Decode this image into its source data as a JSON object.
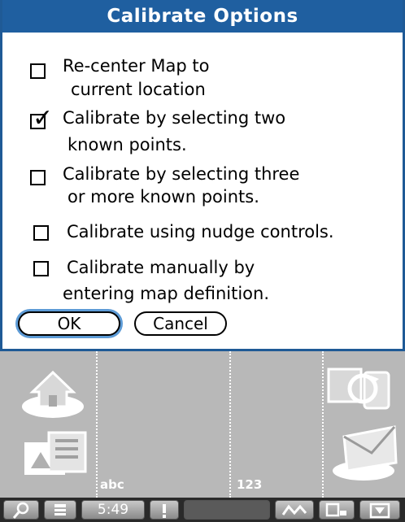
{
  "dialog": {
    "title": "Calibrate Options",
    "options": [
      {
        "line1": "Re-center Map to",
        "line2": "current location",
        "checked": false
      },
      {
        "line1": "Calibrate by selecting two",
        "line2": "known points.",
        "checked": true
      },
      {
        "line1": "Calibrate by selecting three",
        "line2": "or more known points.",
        "checked": false
      },
      {
        "line1": "Calibrate using nudge controls.",
        "line2": "",
        "checked": false
      },
      {
        "line1": "Calibrate manually by",
        "line2": "entering map definition.",
        "checked": false
      }
    ],
    "ok_label": "OK",
    "cancel_label": "Cancel"
  },
  "graffiti": {
    "abc_label": "abc",
    "num_label": "123",
    "icons": [
      "home-icon",
      "applications-icon",
      "sync-icon",
      "mail-icon"
    ]
  },
  "statusbar": {
    "time": "5:49",
    "icons": [
      "find-icon",
      "menu-icon",
      "alert-icon",
      "signal-icon",
      "input-area-icon",
      "collapse-icon"
    ]
  },
  "colors": {
    "title_bar": "#1f5fa0",
    "dialog_border": "#1f5a96",
    "ok_focus_ring": "#5d9bd6",
    "graffiti_bg": "#b8b8b8",
    "statusbar_bg": "#2a2a2a"
  }
}
